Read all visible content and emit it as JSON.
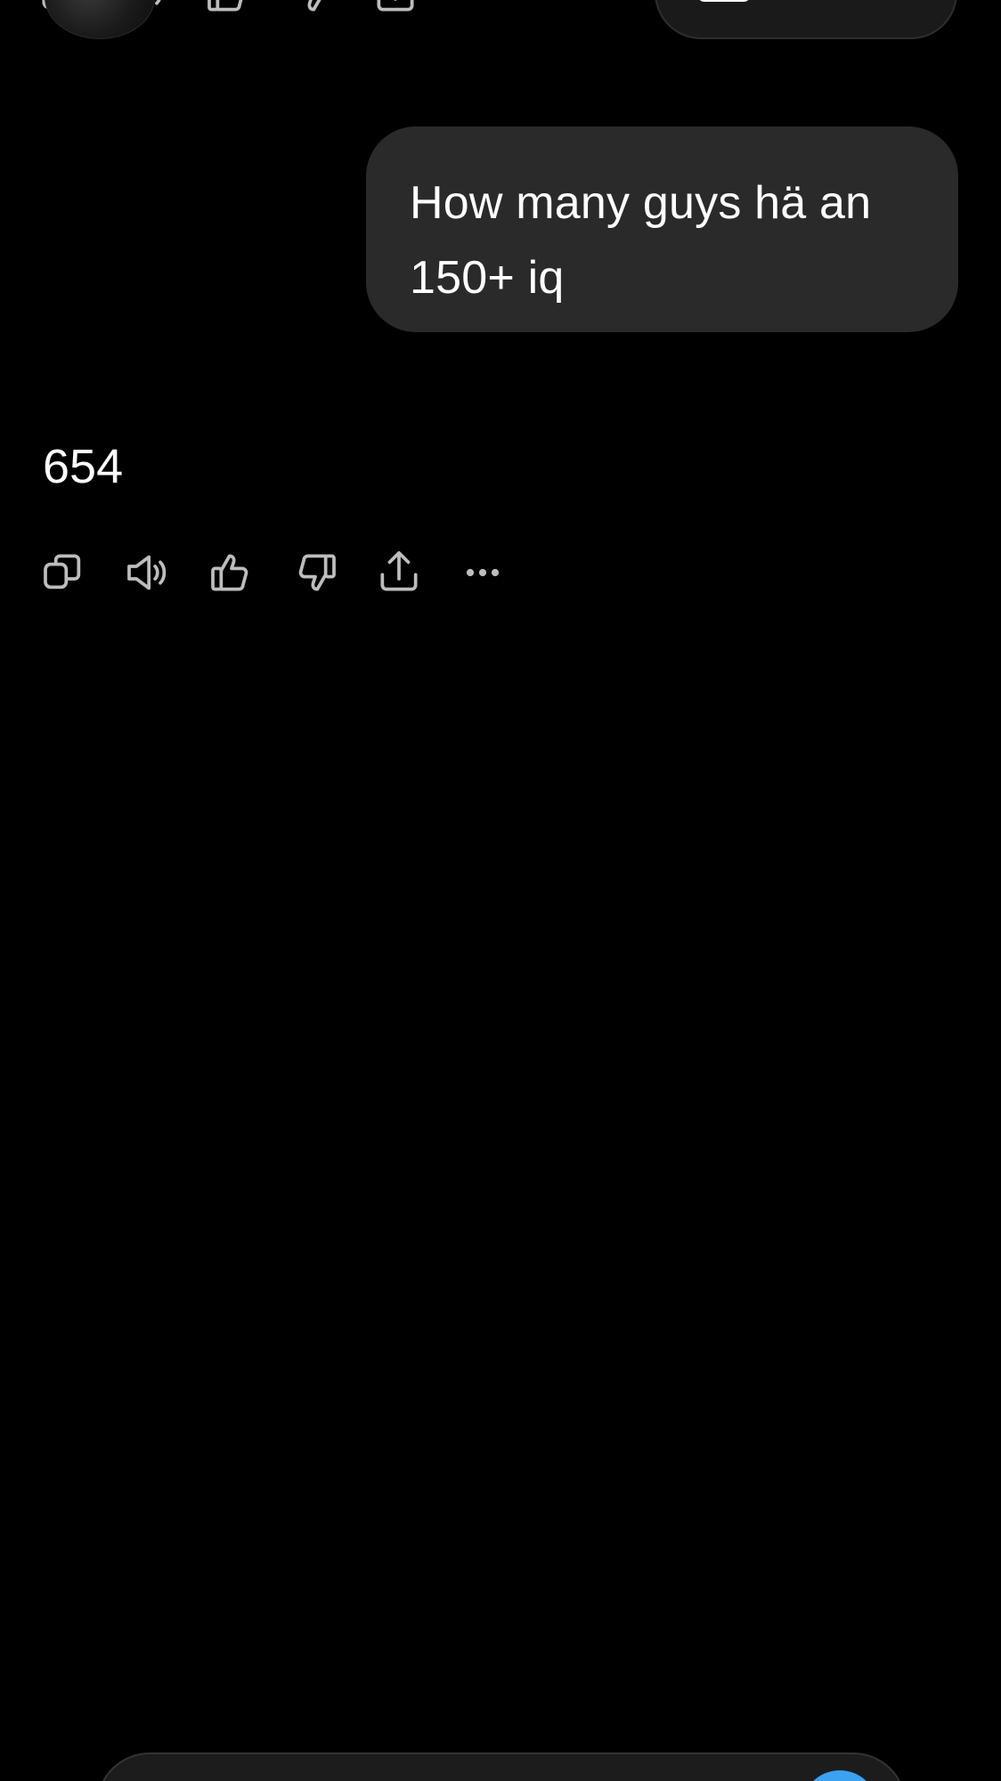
{
  "conversation": {
    "user_message": "How many guys hä an 150+ iq",
    "assistant_reply": "654"
  },
  "actions": [
    {
      "name": "copy-icon"
    },
    {
      "name": "read-aloud-icon"
    },
    {
      "name": "thumbs-up-icon"
    },
    {
      "name": "thumbs-down-icon"
    },
    {
      "name": "share-icon"
    },
    {
      "name": "more-icon"
    }
  ],
  "colors": {
    "background": "#000000",
    "bubble": "#2a2a2a",
    "icon": "#bdbdbd",
    "send_accent": "#3aa2f0"
  }
}
